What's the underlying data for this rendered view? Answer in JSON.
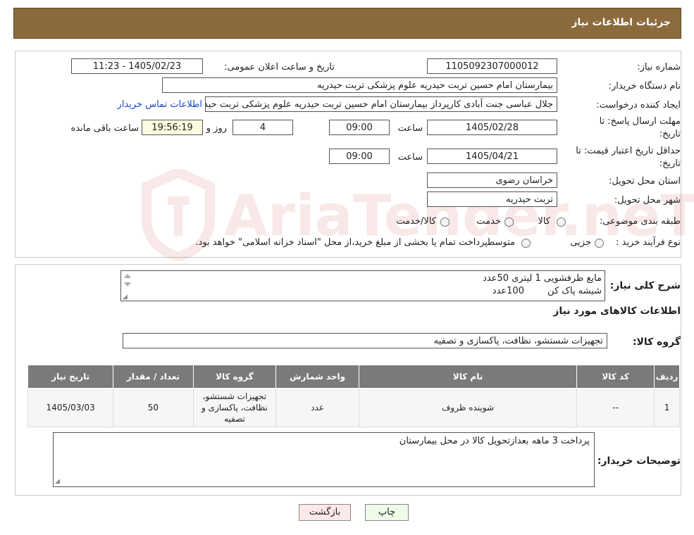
{
  "header": {
    "title": "جزئیات اطلاعات نیاز"
  },
  "form": {
    "need_number": {
      "label": "شماره نیاز:",
      "value": "1105092307000012"
    },
    "announce_datetime": {
      "label": "تاریخ و ساعت اعلان عمومی:",
      "value": "1405/02/23 - 11:23"
    },
    "buyer_org": {
      "label": "نام دستگاه خریدار:",
      "value": "بیمارستان امام حسین تربت حیدریه   علوم پزشکی تربت حیدریه"
    },
    "creator": {
      "label": "ایجاد کننده درخواست:",
      "value": "جلال عباسی جنت آبادی کارپرداز بیمارستان امام حسین تربت حیدریه   علوم پزشکی تربت حیدریه",
      "contact_link": "اطلاعات تماس خریدار"
    },
    "reply_deadline": {
      "label": "مهلت ارسال پاسخ: تا تاریخ:",
      "date": "1405/02/28",
      "time_label": "ساعت",
      "time": "09:00",
      "days": "4",
      "days_label": "روز و",
      "remaining": "19:56:19",
      "remaining_label": "ساعت باقی مانده"
    },
    "price_validity": {
      "label": "حداقل تاریخ اعتبار قیمت: تا تاریخ:",
      "date": "1405/04/21",
      "time_label": "ساعت",
      "time": "09:00"
    },
    "province": {
      "label": "استان محل تحویل:",
      "value": "خراسان رضوی"
    },
    "city": {
      "label": "شهر محل تحویل:",
      "value": "تربت حیدریه"
    },
    "category": {
      "label": "طبقه بندی موضوعی:",
      "options": [
        "کالا",
        "خدمت",
        "کالا/خدمت"
      ]
    },
    "purchase_process": {
      "label": "نوع فرآیند خرید :",
      "options": [
        "جزیی",
        "متوسط"
      ],
      "note": "پرداخت تمام یا بخشی از مبلغ خرید،از محل \"اسناد خزانه اسلامی\" خواهد بود."
    }
  },
  "summary": {
    "label": "شرح کلی نیاز:",
    "lines": [
      "مایع ظرفشویی 1 لیتری 50عدد",
      "شیشه پاک کن        100عدد"
    ]
  },
  "goods": {
    "section_title": "اطلاعات کالاهای مورد نیاز",
    "group_label": "گروه کالا:",
    "group_value": "تجهیزات شستشو، نظافت، پاکسازی و تصفیه",
    "table": {
      "headers": [
        "ردیف",
        "کد کالا",
        "نام کالا",
        "واحد شمارش",
        "گروه کالا",
        "تعداد / مقدار",
        "تاریخ نیاز"
      ],
      "rows": [
        [
          "1",
          "--",
          "شوینده ظروف",
          "عدد",
          "تجهیزات شستشو، نظافت، پاکسازی و تصفیه",
          "50",
          "1405/03/03"
        ]
      ]
    }
  },
  "buyer_notes": {
    "label": "توضیحات خریدار:",
    "value": "پرداخت 3 ماهه بعدازتحویل کالا در محل بیمارستان"
  },
  "buttons": {
    "print": "چاپ",
    "back": "بازگشت"
  },
  "watermark": {
    "text": "AriaTender.neT"
  }
}
